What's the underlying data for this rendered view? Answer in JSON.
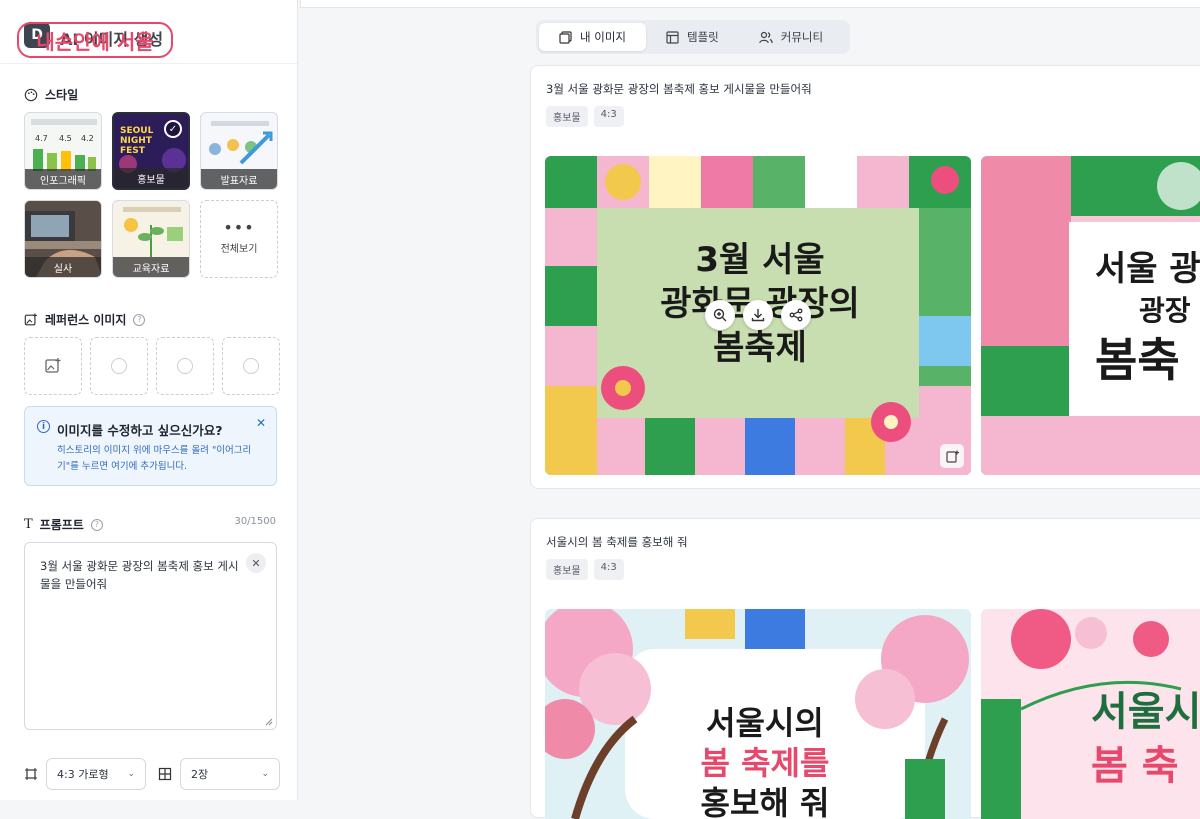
{
  "sidebar": {
    "app_title": "AI 이미지 생성",
    "logo_letter": "D",
    "stamp_text": "내손안에 서울",
    "style_section": {
      "title": "스타일",
      "tiles": [
        {
          "label": "인포그래픽",
          "selected": false
        },
        {
          "label": "홍보물",
          "selected": true,
          "thumb_text": "SEOUL NIGHT FEST"
        },
        {
          "label": "발표자료",
          "selected": false
        },
        {
          "label": "실사",
          "selected": false
        },
        {
          "label": "교육자료",
          "selected": false
        },
        {
          "label": "전체보기",
          "icon": "more-dots-icon"
        }
      ]
    },
    "reference_section": {
      "title": "레퍼런스 이미지",
      "slots": 4
    },
    "info_box": {
      "title": "이미지를 수정하고 싶으신가요?",
      "description": "히스토리의 이미지 위에 마우스를 올려 \"이어그리기\"를 누르면 여기에 추가됩니다."
    },
    "prompt_section": {
      "title": "프롬프트",
      "counter": "30/1500",
      "value": "3월 서울 광화문 광장의 봄축제 홍보 게시물을 만들어줘"
    },
    "ratio_select": "4:3 가로형",
    "count_select": "2장"
  },
  "tabs": [
    {
      "label": "내 이미지",
      "icon": "images-icon",
      "active": true
    },
    {
      "label": "템플릿",
      "icon": "template-icon",
      "active": false
    },
    {
      "label": "커뮤니티",
      "icon": "users-icon",
      "active": false
    }
  ],
  "history": [
    {
      "prompt": "3월 서울 광화문 광장의 봄축제 홍보 게시물을 만들어줘",
      "tags": [
        "홍보물",
        "4:3"
      ],
      "images": [
        {
          "lines": [
            "3월 서울",
            "광화문 광장의",
            "봄축제"
          ]
        },
        {
          "lines": [
            "서울 광",
            "광장",
            "봄축"
          ]
        }
      ]
    },
    {
      "prompt": "서울시의 봄 축제를 홍보해 줘",
      "tags": [
        "홍보물",
        "4:3"
      ],
      "images": [
        {
          "lines": [
            "서울시의",
            "봄 축제를",
            "홍보해 줘"
          ]
        },
        {
          "lines": [
            "서울시",
            "봄 축"
          ]
        }
      ]
    }
  ],
  "colors": {
    "accent_pink": "#e8486b",
    "info_blue": "#2f6bbd",
    "poster_green": "#2e9e4f",
    "poster_pink": "#f3a9c6"
  }
}
